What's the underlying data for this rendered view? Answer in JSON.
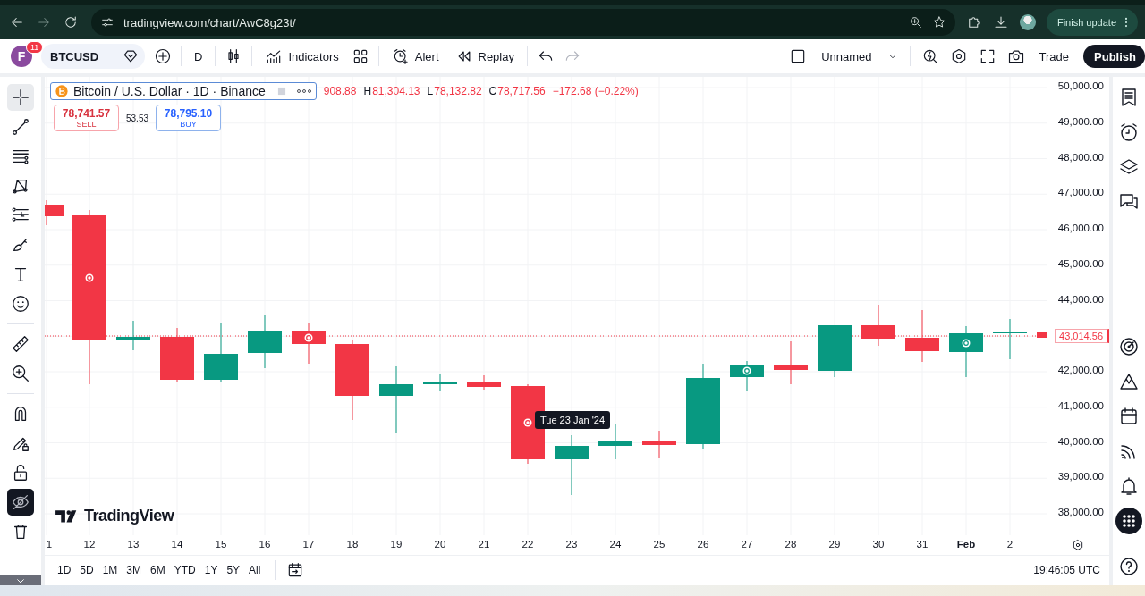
{
  "browser": {
    "url": "tradingview.com/chart/AwC8g23t/",
    "update_button": "Finish update"
  },
  "toolbar": {
    "avatar_letter": "F",
    "notification_count": "11",
    "symbol": "BTCUSD",
    "interval": "D",
    "indicators": "Indicators",
    "alert": "Alert",
    "replay": "Replay",
    "layout_name": "Unnamed",
    "trade": "Trade",
    "publish": "Publish"
  },
  "left_tools": [
    [
      {
        "kind": "crosshair",
        "active": true
      },
      {
        "kind": "trend-line",
        "active": false
      },
      {
        "kind": "parallel-lines",
        "active": false
      },
      {
        "kind": "pattern",
        "active": false
      },
      {
        "kind": "projection-lines",
        "active": false
      },
      {
        "kind": "brush",
        "active": false
      },
      {
        "kind": "text",
        "active": false
      },
      {
        "kind": "emoji",
        "active": false
      }
    ],
    [
      {
        "kind": "ruler",
        "active": false
      },
      {
        "kind": "zoom-in",
        "active": false
      }
    ],
    [
      {
        "kind": "magnet",
        "active": false
      },
      {
        "kind": "pencil-lock",
        "active": false
      },
      {
        "kind": "lock",
        "active": false
      },
      {
        "kind": "eye-off",
        "active": true
      },
      {
        "kind": "trash",
        "active": false
      }
    ]
  ],
  "legend": {
    "title": "Bitcoin / U.S. Dollar · 1D · Binance",
    "ohlc": [
      {
        "value": "908.88"
      },
      {
        "label": "H",
        "value": "81,304.13"
      },
      {
        "label": "L",
        "value": "78,132.82"
      },
      {
        "label": "C",
        "value": "78,717.56"
      }
    ],
    "change": "−172.68 (−0.22%)"
  },
  "trade_panel": {
    "sell_price": "78,741.57",
    "sell_label": "SELL",
    "spread": "53.53",
    "buy_price": "78,795.10",
    "buy_label": "BUY"
  },
  "price_axis": {
    "ticks": [
      "50,000.00",
      "49,000.00",
      "48,000.00",
      "47,000.00",
      "46,000.00",
      "45,000.00",
      "44,000.00",
      "42,000.00",
      "41,000.00",
      "40,000.00",
      "39,000.00",
      "38,000.00"
    ],
    "last_price": "43,014.56"
  },
  "time_axis": {
    "ticks": [
      {
        "label": "1",
        "kind": "day"
      },
      {
        "label": "12",
        "kind": "day"
      },
      {
        "label": "13",
        "kind": "day"
      },
      {
        "label": "14",
        "kind": "day"
      },
      {
        "label": "15",
        "kind": "day"
      },
      {
        "label": "16",
        "kind": "day"
      },
      {
        "label": "17",
        "kind": "day"
      },
      {
        "label": "18",
        "kind": "day"
      },
      {
        "label": "19",
        "kind": "day"
      },
      {
        "label": "20",
        "kind": "day"
      },
      {
        "label": "21",
        "kind": "day"
      },
      {
        "label": "22",
        "kind": "day"
      },
      {
        "label": "23",
        "kind": "day"
      },
      {
        "label": "24",
        "kind": "day"
      },
      {
        "label": "25",
        "kind": "day"
      },
      {
        "label": "26",
        "kind": "day"
      },
      {
        "label": "27",
        "kind": "day"
      },
      {
        "label": "28",
        "kind": "day"
      },
      {
        "label": "29",
        "kind": "day"
      },
      {
        "label": "30",
        "kind": "day"
      },
      {
        "label": "31",
        "kind": "day"
      },
      {
        "label": "Feb",
        "kind": "month"
      },
      {
        "label": "2",
        "kind": "day"
      }
    ]
  },
  "tooltip": "Tue 23 Jan '24",
  "logo": "TradingView",
  "range_bar": {
    "ranges": [
      "1D",
      "5D",
      "1M",
      "3M",
      "6M",
      "YTD",
      "1Y",
      "5Y",
      "All"
    ],
    "time": "19:46:05 UTC"
  },
  "right_sidebar": [
    {
      "kind": "watchlist"
    },
    {
      "kind": "alarm-clock"
    },
    {
      "kind": "layers"
    },
    {
      "kind": "chat"
    },
    {
      "kind": "gap"
    },
    {
      "kind": "target"
    },
    {
      "kind": "mountain"
    },
    {
      "kind": "calendar"
    },
    {
      "kind": "broadcast"
    },
    {
      "kind": "bell"
    },
    {
      "kind": "apps"
    }
  ]
}
